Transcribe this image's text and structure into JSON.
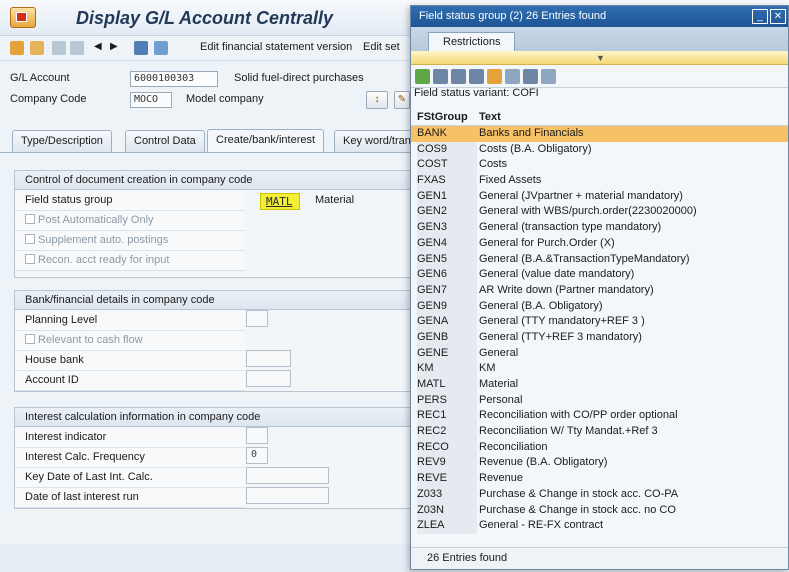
{
  "main": {
    "title": "Display G/L Account Centrally",
    "toolbar": {
      "edit_fs_version": "Edit financial statement version",
      "edit_set": "Edit set"
    },
    "header": {
      "gl_account_label": "G/L Account",
      "gl_account_value": "6000100303",
      "gl_account_desc": "Solid fuel-direct purchases",
      "company_code_label": "Company Code",
      "company_code_value": "MOCO",
      "company_code_desc": "Model company"
    },
    "tabs": [
      {
        "label": "Type/Description"
      },
      {
        "label": "Control Data"
      },
      {
        "label": "Create/bank/interest"
      },
      {
        "label": "Key word/tran"
      }
    ],
    "doc_creation": {
      "title": "Control of document creation in company code",
      "field_status_group_label": "Field status group",
      "field_status_group_value": "MATL",
      "field_status_group_desc": "Material",
      "post_auto_label": "Post Automatically Only",
      "supplement_label": "Supplement auto. postings",
      "recon_label": "Recon. acct ready for input"
    },
    "bank": {
      "title": "Bank/financial details in company code",
      "planning_level_label": "Planning Level",
      "relevant_cash_label": "Relevant to cash flow",
      "house_bank_label": "House bank",
      "account_id_label": "Account ID"
    },
    "interest": {
      "title": "Interest calculation information in company code",
      "indicator_label": "Interest indicator",
      "frequency_label": "Interest Calc. Frequency",
      "frequency_value": "0",
      "key_date_label": "Key Date of Last Int. Calc.",
      "last_run_label": "Date of last interest run"
    }
  },
  "popup": {
    "title": "Field status group (2)   26 Entries found",
    "tab_restrictions": "Restrictions",
    "variant": "Field status variant: COFI",
    "col_group": "FStGroup",
    "col_text": "Text",
    "status": "26 Entries found",
    "rows": [
      {
        "code": "BANK",
        "text": "Banks and Financials",
        "selected": true
      },
      {
        "code": "COS9",
        "text": "Costs (B.A. Obligatory)"
      },
      {
        "code": "COST",
        "text": "Costs"
      },
      {
        "code": "FXAS",
        "text": "Fixed Assets"
      },
      {
        "code": "GEN1",
        "text": "General (JVpartner + material mandatory)"
      },
      {
        "code": "GEN2",
        "text": "General with WBS/purch.order(2230020000)"
      },
      {
        "code": "GEN3",
        "text": "General (transaction type mandatory)"
      },
      {
        "code": "GEN4",
        "text": "General for Purch.Order (X)"
      },
      {
        "code": "GEN5",
        "text": "General (B.A.&TransactionTypeMandatory)"
      },
      {
        "code": "GEN6",
        "text": "General (value date mandatory)"
      },
      {
        "code": "GEN7",
        "text": "AR Write down (Partner mandatory)"
      },
      {
        "code": "GEN9",
        "text": "General (B.A. Obligatory)"
      },
      {
        "code": "GENA",
        "text": "General (TTY mandatory+REF 3 )"
      },
      {
        "code": "GENB",
        "text": "General (TTY+REF 3 mandatory)"
      },
      {
        "code": "GENE",
        "text": "General"
      },
      {
        "code": "KM",
        "text": "KM"
      },
      {
        "code": "MATL",
        "text": "Material"
      },
      {
        "code": "PERS",
        "text": "Personal"
      },
      {
        "code": "REC1",
        "text": "Reconciliation with CO/PP order optional"
      },
      {
        "code": "REC2",
        "text": "Reconciliation W/ Tty Mandat.+Ref 3"
      },
      {
        "code": "RECO",
        "text": "Reconciliation"
      },
      {
        "code": "REV9",
        "text": "Revenue (B.A. Obligatory)"
      },
      {
        "code": "REVE",
        "text": "Revenue"
      },
      {
        "code": "Z033",
        "text": "Purchase & Change in stock acc. CO-PA"
      },
      {
        "code": "Z03N",
        "text": "Purchase & Change in stock acc. no CO"
      },
      {
        "code": "ZLEA",
        "text": "General - RE-FX contract"
      }
    ]
  }
}
